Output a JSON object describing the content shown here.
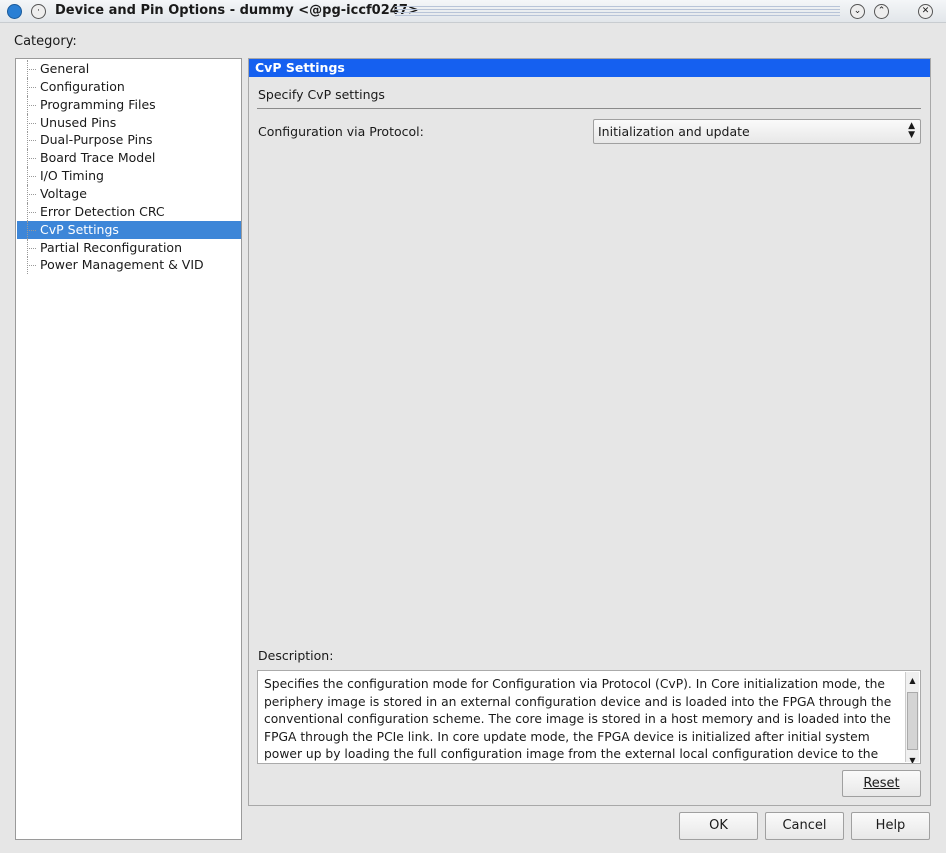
{
  "window": {
    "title": "Device and Pin Options - dummy <@pg-iccf0247>"
  },
  "category_label": "Category:",
  "tree": [
    "General",
    "Configuration",
    "Programming Files",
    "Unused Pins",
    "Dual-Purpose Pins",
    "Board Trace Model",
    "I/O Timing",
    "Voltage",
    "Error Detection CRC",
    "CvP Settings",
    "Partial Reconfiguration",
    "Power Management & VID"
  ],
  "selected": "CvP Settings",
  "panel": {
    "header": "CvP Settings",
    "subtitle": "Specify CvP settings",
    "field_label": "Configuration via Protocol:",
    "field_value": "Initialization and update",
    "description_label": "Description:",
    "description": "Specifies the configuration mode for Configuration via Protocol (CvP). In Core initialization mode, the periphery image is stored in an external configuration device and is loaded into the FPGA through the conventional configuration scheme. The core image is stored in a host memory and is loaded into the FPGA through the PCIe link. In core update mode, the FPGA device is initialized after initial system power up by loading the full configuration image from the external local configuration device to the",
    "reset": "Reset"
  },
  "buttons": {
    "ok": "OK",
    "cancel": "Cancel",
    "help": "Help"
  },
  "colors": {
    "header": "#1560f0",
    "selection": "#3d86d8"
  }
}
